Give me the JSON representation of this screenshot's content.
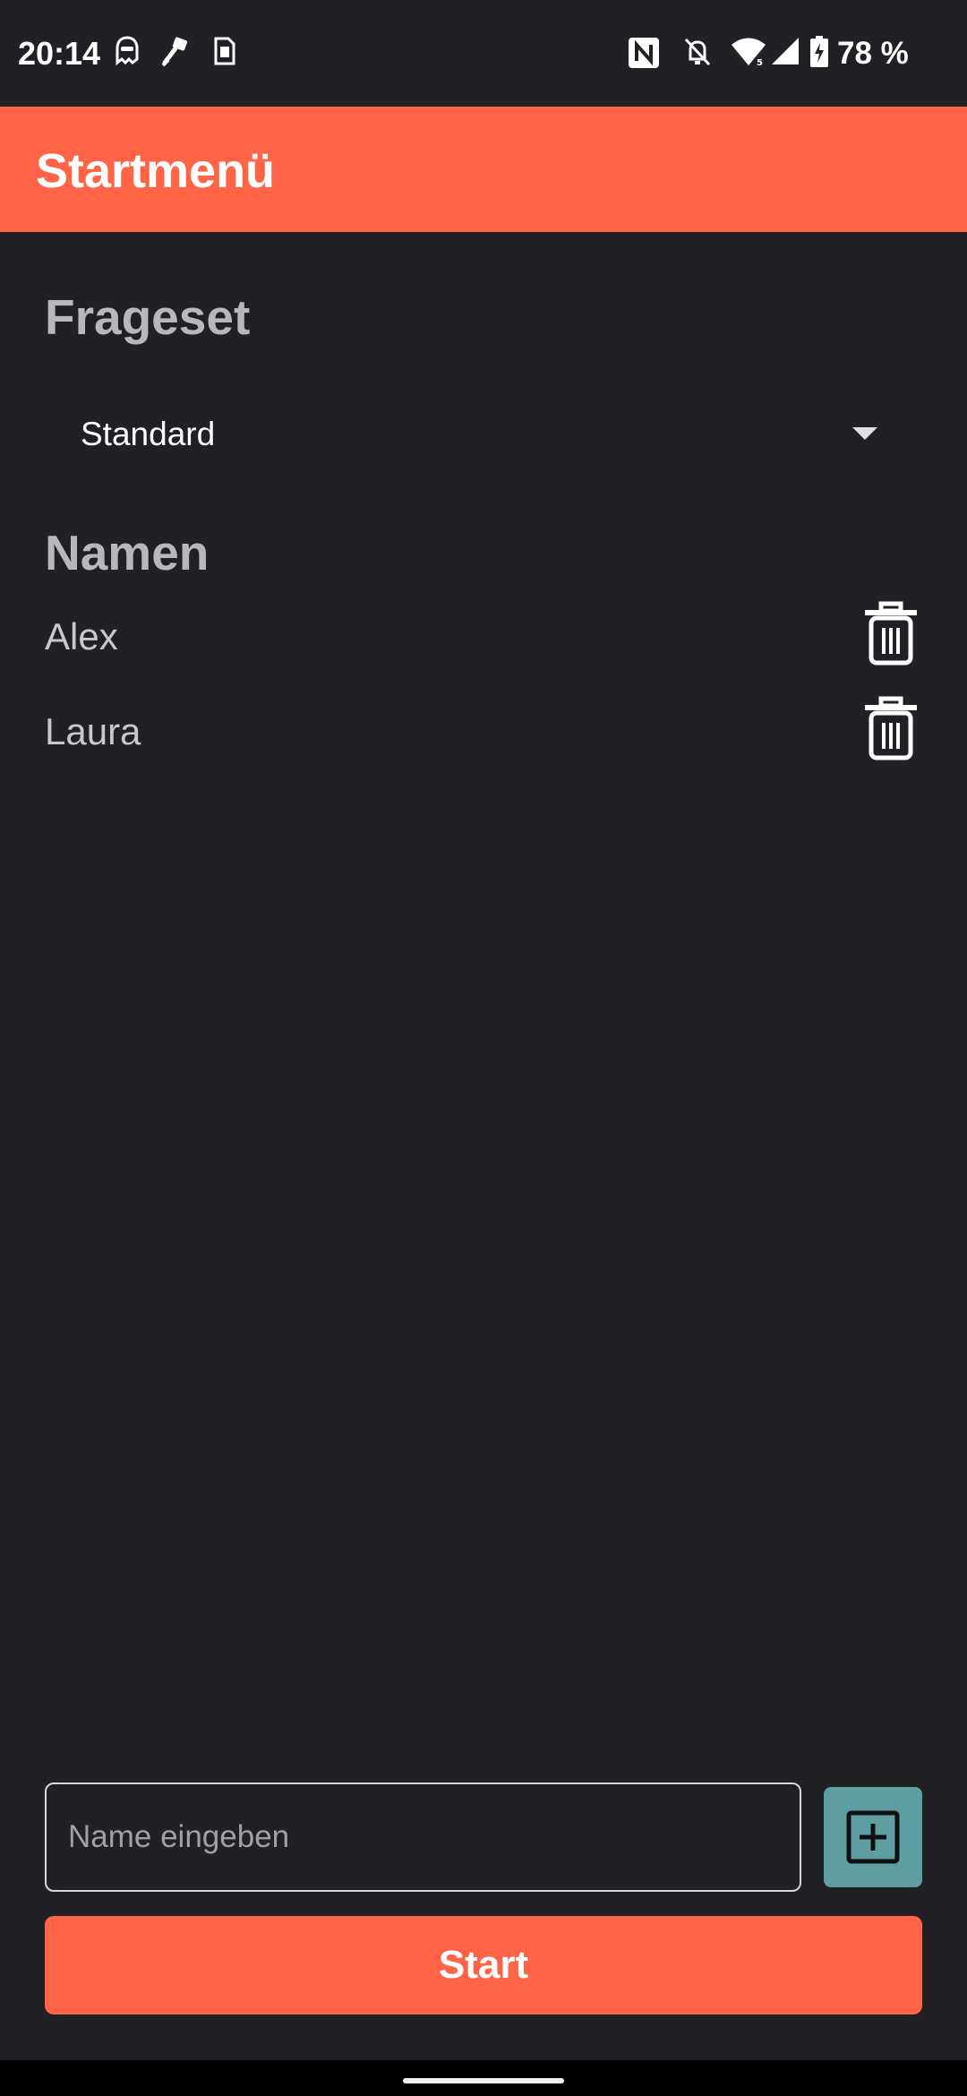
{
  "status_bar": {
    "time": "20:14",
    "battery_percent": "78 %",
    "icons_left": [
      "ghost-icon",
      "paint-roller-icon",
      "sim-card-icon"
    ],
    "icons_right": [
      "nfc-icon",
      "bell-off-icon",
      "wifi-icon",
      "signal-icon",
      "battery-charging-icon"
    ]
  },
  "app_bar": {
    "title": "Startmenü",
    "color": "#ff6447"
  },
  "question_set": {
    "heading": "Frageset",
    "selected": "Standard"
  },
  "names": {
    "heading": "Namen",
    "items": [
      {
        "label": "Alex",
        "action_icon": "trash-icon"
      },
      {
        "label": "Laura",
        "action_icon": "trash-icon"
      }
    ]
  },
  "input": {
    "placeholder": "Name eingeben",
    "value": ""
  },
  "add_button": {
    "icon": "plus-square-icon",
    "color": "#5e9ea0"
  },
  "start_button": {
    "label": "Start",
    "color": "#ff6447"
  }
}
